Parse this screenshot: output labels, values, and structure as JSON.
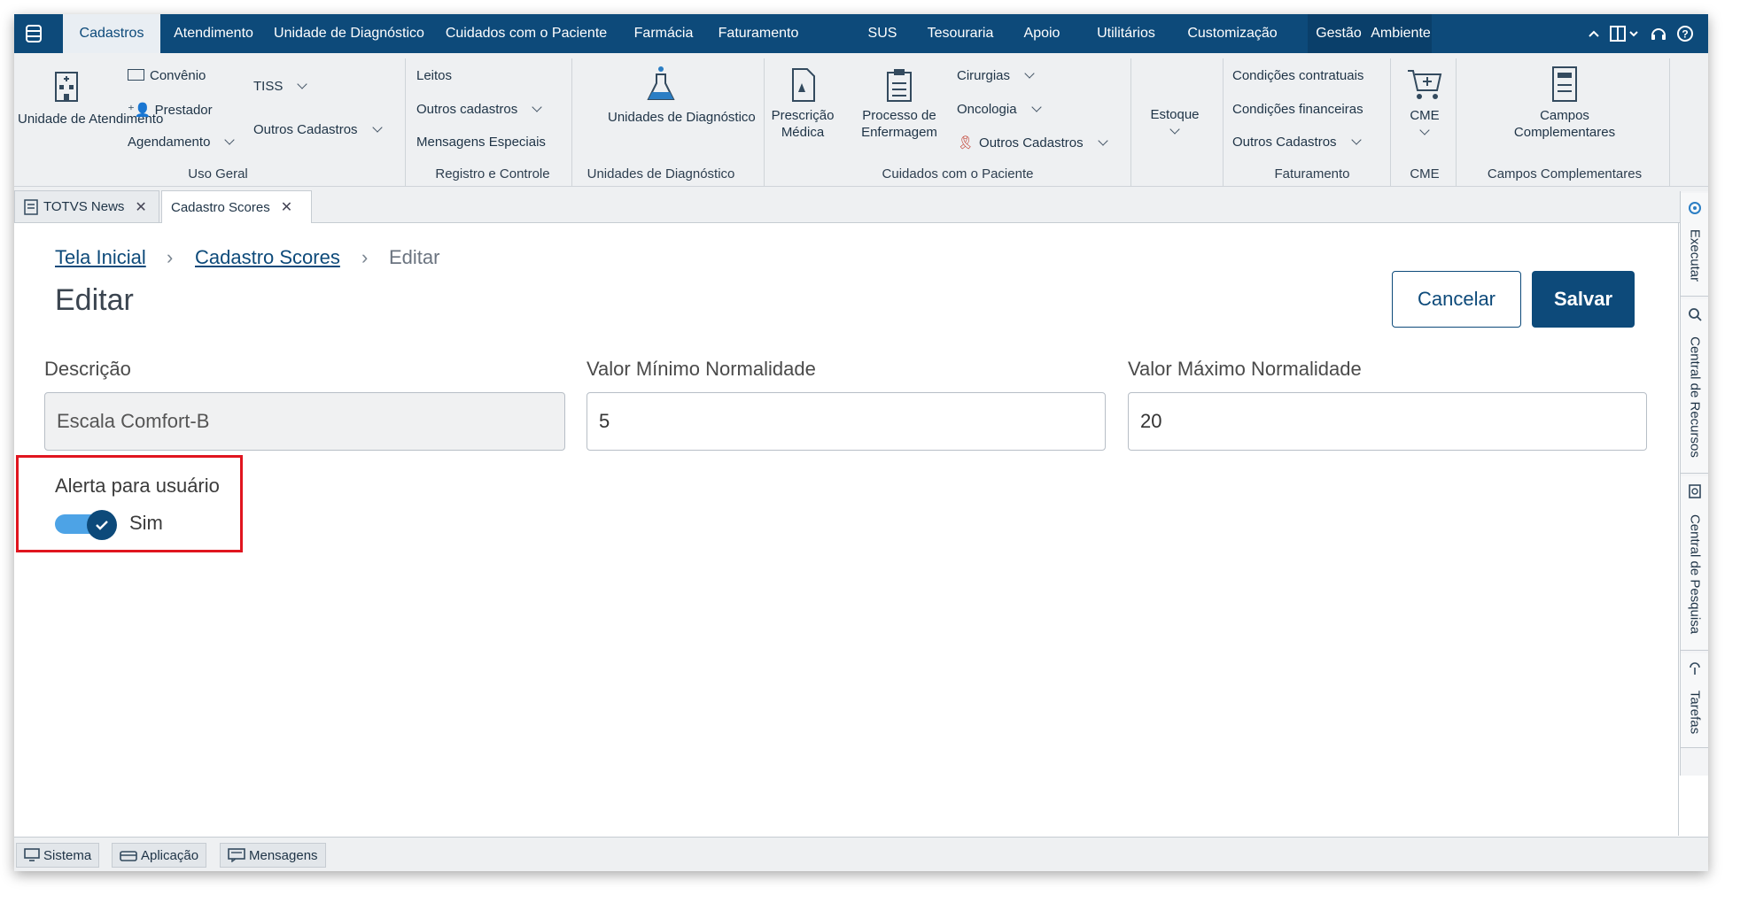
{
  "menubar": {
    "tabs": [
      "Cadastros",
      "Atendimento",
      "Unidade de Diagnóstico",
      "Cuidados com o Paciente",
      "Farmácia",
      "Faturamento",
      "SUS",
      "Tesouraria",
      "Apoio",
      "Utilitários",
      "Customização",
      "Gestão",
      "Ambiente"
    ],
    "active_tab": "Cadastros"
  },
  "ribbon": {
    "uso_geral": {
      "unidade_atendimento": "Unidade de Atendimento",
      "convenio": "Convênio",
      "prestador": "Prestador",
      "agendamento": "Agendamento",
      "tiss": "TISS",
      "outros_cadastros": "Outros Cadastros",
      "group_label": "Uso Geral"
    },
    "registro": {
      "leitos": "Leitos",
      "outros_cadastros": "Outros cadastros",
      "mensagens": "Mensagens Especiais",
      "group_label": "Registro e Controle"
    },
    "diagnostico": {
      "unidades": "Unidades de Diagnóstico",
      "group_label": "Unidades de Diagnóstico"
    },
    "cuidados": {
      "prescricao": "Prescrição Médica",
      "processo": "Processo de Enfermagem",
      "cirurgias": "Cirurgias",
      "oncologia": "Oncologia",
      "outros_cadastros": "Outros Cadastros",
      "group_label": "Cuidados com o Paciente"
    },
    "estoque": {
      "label": "Estoque"
    },
    "faturamento": {
      "condicoes_contratuais": "Condições contratuais",
      "condicoes_financeiras": "Condições financeiras",
      "outros_cadastros": "Outros Cadastros",
      "group_label": "Faturamento"
    },
    "cme": {
      "label": "CME",
      "group_label": "CME"
    },
    "campos": {
      "label": "Campos Complementares",
      "group_label": "Campos Complementares"
    }
  },
  "doc_tabs": [
    {
      "label": "TOTVS News"
    },
    {
      "label": "Cadastro Scores"
    }
  ],
  "breadcrumb": {
    "home": "Tela Inicial",
    "section": "Cadastro Scores",
    "current": "Editar"
  },
  "page": {
    "title": "Editar",
    "cancel_label": "Cancelar",
    "save_label": "Salvar"
  },
  "form": {
    "descricao_label": "Descrição",
    "descricao_value": "Escala Comfort-B",
    "min_label": "Valor Mínimo Normalidade",
    "min_value": "5",
    "max_label": "Valor Máximo Normalidade",
    "max_value": "20",
    "alert_label": "Alerta para usuário",
    "alert_state_text": "Sim",
    "alert_enabled": true
  },
  "side_rail": {
    "items": [
      "Executar",
      "Central de Recursos",
      "Central de Pesquisa",
      "Tarefas"
    ]
  },
  "status_bar": {
    "sistema": "Sistema",
    "aplicacao": "Aplicação",
    "mensagens": "Mensagens"
  },
  "colors": {
    "primary": "#0d4a7a",
    "toggle_track": "#4da3e6",
    "highlight_border": "#e0151f"
  }
}
